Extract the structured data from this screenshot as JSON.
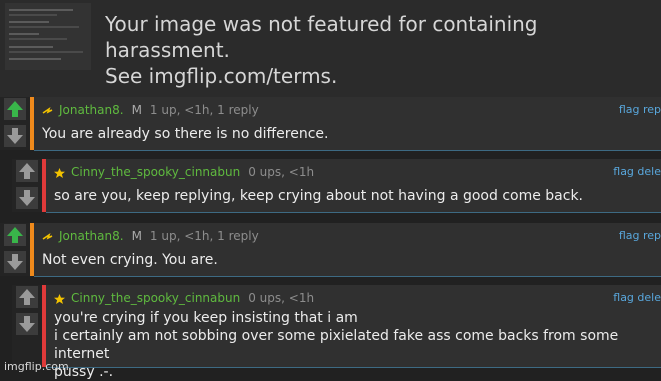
{
  "banner": {
    "message": "Your image was not featured for containing harassment.\nSee imgflip.com/terms."
  },
  "comments": [
    {
      "username": "Jonathan8.",
      "badge": "M",
      "stats": "1 up, <1h, 1 reply",
      "actions": "flag rep",
      "text": "You are already so there is no difference.",
      "accent_color": "#ef8a1c",
      "user_icon": "rank-icon"
    },
    {
      "username": "Cinny_the_spooky_cinnabun",
      "badge": "",
      "stats": "0 ups, <1h",
      "actions": "flag dele",
      "text": "so are you, keep replying, keep crying about not having a good come back.",
      "accent_color": "#e03a3a",
      "user_icon": "star-icon"
    },
    {
      "username": "Jonathan8.",
      "badge": "M",
      "stats": "1 up, <1h, 1 reply",
      "actions": "flag rep",
      "text": "Not even crying. You are.",
      "accent_color": "#ef8a1c",
      "user_icon": "rank-icon"
    },
    {
      "username": "Cinny_the_spooky_cinnabun",
      "badge": "",
      "stats": "0 ups, <1h",
      "actions": "flag dele",
      "text": "you're crying if you keep insisting that i am\ni certainly am not sobbing over some pixielated fake ass come backs from some internet\npussy .-.",
      "accent_color": "#e03a3a",
      "user_icon": "star-icon"
    }
  ],
  "colors": {
    "upvote": "#39b54a",
    "downvote": "#9a9a9a",
    "username": "#5fba3f",
    "link": "#59a7dc"
  },
  "watermark": "imgflip.com"
}
